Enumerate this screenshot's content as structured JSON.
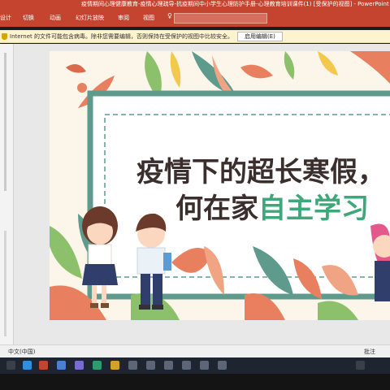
{
  "window": {
    "title": "疫情期间心理健康教育-疫情心理疏导-抗疫期间中小学生心理防护手册-心理教育培训课件(1) [受保护的视图] - PowerPoint"
  },
  "ribbon": {
    "tabs": [
      "设计",
      "切换",
      "动画",
      "幻灯片放映",
      "审阅",
      "视图"
    ]
  },
  "infobar": {
    "message": "Internet 的文件可能包含病毒。除非您需要编辑，否则保持在受保护的视图中比较安全。",
    "enable_button": "启用编辑(E)"
  },
  "slide": {
    "title_line1": "疫情下的超长寒假，",
    "title_line2_prefix": "何在家",
    "title_line2_highlight": "自主学习",
    "colors": {
      "background": "#fbf5ea",
      "frame_green": "#5e9b8c",
      "title_dark": "#3a2f2c",
      "highlight_green": "#3ea87a",
      "leaf_coral": "#e8805f",
      "leaf_green": "#8dc06a"
    }
  },
  "statusbar": {
    "language": "中文(中国)",
    "notes": "批注"
  }
}
